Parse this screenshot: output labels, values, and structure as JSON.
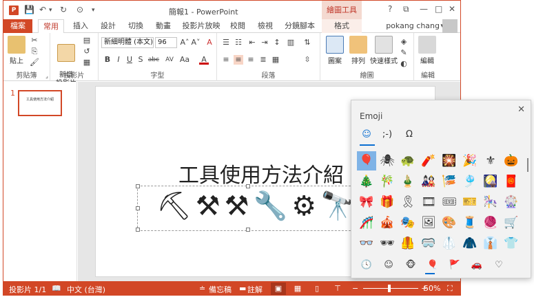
{
  "window": {
    "title": "簡報1 - PowerPoint",
    "context_tab_title": "繪圖工具",
    "app_logo": "P",
    "help": "?",
    "ribbon_display": "⧉",
    "minimize": "—",
    "maximize": "□",
    "close": "✕"
  },
  "quick_access": {
    "save": "💾",
    "undo": "↶",
    "undo_dd": "▾",
    "redo": "↻",
    "presenter": "⊙",
    "customize": "▾"
  },
  "tabs": [
    "檔案",
    "常用",
    "插入",
    "設計",
    "切換",
    "動畫",
    "投影片放映",
    "校閱",
    "檢視",
    "分鏡腳本",
    "格式"
  ],
  "user": {
    "name": "pokang chang",
    "dropdown": "▾"
  },
  "ribbon": {
    "groups": [
      "剪貼簿",
      "投影片",
      "字型",
      "段落",
      "繪圖",
      "編輯"
    ],
    "paste_label": "貼上",
    "new_slide_label": "新增\n投影片",
    "font_name": "新細明體 (本文)",
    "font_size": "96",
    "font_grow": "A˄",
    "font_shrink": "A˅",
    "clear_format": "A",
    "bold": "B",
    "italic": "I",
    "underline": "U",
    "strike": "S",
    "strike2": "abc",
    "spacing": "AV",
    "case": "Aa",
    "font_color": "A",
    "shape_label": "圖案",
    "arrange_label": "排列",
    "quick_style_label": "快速樣式",
    "edit_label": "編輯",
    "launcher": "⌟"
  },
  "thumbnail": {
    "number": "1",
    "title": "工具使用方法介紹"
  },
  "slide": {
    "title": "工具使用方法介紹",
    "tools": "⛏⚒⚒🔧⚙🔭⚗"
  },
  "status": {
    "slide_info": "投影片 1/1",
    "language": "中文 (台灣)",
    "notes": "備忘稿",
    "comments": "註解",
    "zoom": "50%",
    "zoom_minus": "−",
    "zoom_plus": "+"
  },
  "emoji_panel": {
    "title": "Emoji",
    "close": "✕",
    "tabs": [
      "☺",
      ";-)",
      "Ω"
    ],
    "grid": [
      "🎈",
      "🕷",
      "🐢",
      "🧨",
      "🎇",
      "🎉",
      "⚜",
      "🎃",
      "🎄",
      "🎋",
      "🎍",
      "🎎",
      "🎏",
      "🎐",
      "🎑",
      "🧧",
      "🎀",
      "🎁",
      "🎗",
      "🎞",
      "🎟",
      "🎫",
      "🎠",
      "🎡",
      "🎢",
      "🎪",
      "🎭",
      "🖼",
      "🎨",
      "🧵",
      "🧶",
      "🛒",
      "👓",
      "🕶",
      "🦺",
      "🥽",
      "🥼",
      "🧥",
      "👔",
      "👕"
    ],
    "categories": [
      "🕓",
      "☺",
      "🐵",
      "🎈",
      "🚩",
      "🚗",
      "♡"
    ]
  }
}
